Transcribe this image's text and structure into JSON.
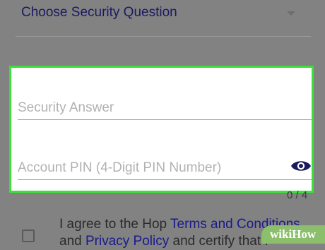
{
  "security_question": {
    "label": "Choose Security Question"
  },
  "security_answer": {
    "placeholder": "Security Answer"
  },
  "account_pin": {
    "placeholder": "Account PIN (4-Digit PIN Number)",
    "counter": "0 / 4"
  },
  "agreement": {
    "prefix": "I agree to the Hop ",
    "terms_link": "Terms and Conditions",
    "middle": "and ",
    "privacy_link": "Privacy Policy",
    "suffix": " and certify that I"
  },
  "watermark": {
    "text": "wikiHow"
  },
  "colors": {
    "highlight_border": "#3de03a",
    "link": "#1a1a8a",
    "icon": "#1a1a63"
  },
  "icons": {
    "dropdown": "chevron-down-icon",
    "visibility": "eye-icon"
  }
}
